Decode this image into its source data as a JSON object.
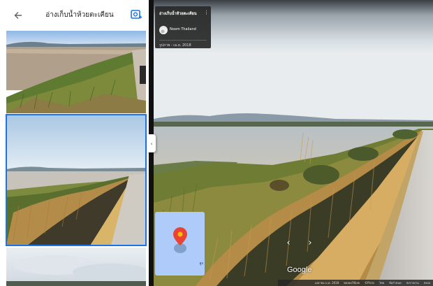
{
  "left_panel": {
    "title": "อ่างเก็บน้ำห้วยตะเคียน",
    "back_icon": "arrow-left-icon",
    "add_photo_icon": "add-photo-icon",
    "collapse_icon": "chevron-left-icon",
    "thumbnails": [
      {
        "name": "photo-thumbnail-1",
        "selected": false
      },
      {
        "name": "photo-thumbnail-2",
        "selected": true
      },
      {
        "name": "photo-thumbnail-3",
        "selected": false
      }
    ]
  },
  "info_card": {
    "title": "อ่างเก็บน้ำห้วยตะเคียน",
    "more_icon": "more-vert-icon",
    "author": "Noom Thailand",
    "date": "รูปภาพ - เม.ย. 2018"
  },
  "street_view": {
    "logo": "Google",
    "nav_left": "‹",
    "nav_right": "›",
    "minimap_label": "สูง"
  },
  "footer": {
    "items": [
      "เมษายน ม.ค. 2018",
      "ทดลองใช้เลย",
      "©Picss",
      "ไทย",
      "ข้อกำหนด",
      "ส่งรายงาน",
      "ส่งผล"
    ]
  },
  "colors": {
    "accent": "#1a73e8",
    "card_bg": "#282828",
    "minimap_bg": "#aecbfa",
    "pin": "#ea4335"
  }
}
